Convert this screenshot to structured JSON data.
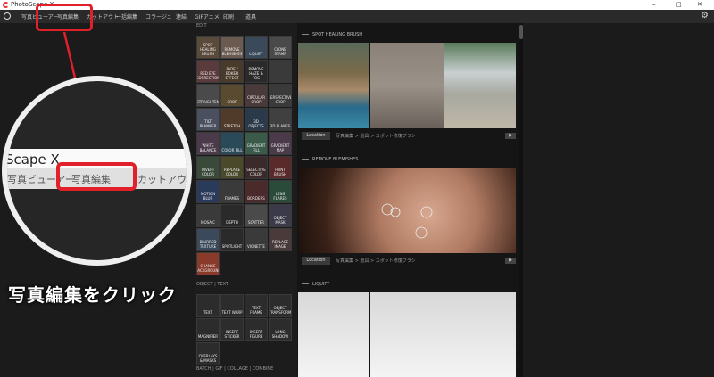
{
  "window": {
    "title": "PhotoScape X",
    "min": "–",
    "max": "□",
    "close": "✕"
  },
  "menu": {
    "items": [
      "写真ビューアー",
      "写真編集",
      "カットアウト",
      "一括編集",
      "コラージュ",
      "連結",
      "GIFアニメ",
      "印刷",
      "道具"
    ]
  },
  "icons": {
    "search": "search-icon",
    "settings": "gear-icon"
  },
  "callout": {
    "title": "Scape X",
    "items": [
      "写真ビューアー",
      "写真編集",
      "カットアウト"
    ]
  },
  "caption": "写真編集をクリック",
  "edit_panel": {
    "sections": [
      "EDIT",
      "OBJECT | TEXT",
      "BATCH | GIF | COLLAGE | COMBINE"
    ],
    "tools": [
      "SPOT HEALING BRUSH",
      "REMOVE BLEMISHES",
      "LIQUIFY",
      "CLONE STAMP",
      "RED EYE CORRECTION",
      "FADE / BOKEH EFFECT",
      "REMOVE HAZE & FOG",
      "",
      "STRAIGHTEN",
      "CROP",
      "CIRCULAR CROP",
      "PERSPECTIVE CROP",
      "TILT PLANNER",
      "STRETCH",
      "3D OBJECTS",
      "3D PLANES",
      "WHITE BALANCE",
      "COLOR FILL",
      "GRADIENT FILL",
      "GRADIENT MAP",
      "INVERT COLOR",
      "REPLACE COLOR",
      "SELECTIVE COLOR",
      "PAINT BRUSH",
      "MOTION BLUR",
      "FRAMES",
      "BORDERS",
      "LENS FLARES",
      "MOSAIC",
      "DEPTH",
      "SCATTER",
      "OBJECT MASK",
      "BLURRED TEXTURE",
      "SPOTLIGHT",
      "VIGNETTE",
      "REPLACE IMAGE",
      "CHANGE BACKGROUND"
    ],
    "object_tools": [
      "TEXT",
      "TEXT WARP",
      "TEXT FRAME",
      "OBJECT TRANSFORM",
      "MAGNIFIER",
      "INSERT STICKER",
      "INSERT FIGURE",
      "LONG SHADOW",
      "OVERLAYS & MASKS"
    ]
  },
  "previews": [
    {
      "title": "SPOT HEALING BRUSH",
      "location": "Location",
      "path": "写真編集 > 道具 > スポット修復ブラシ"
    },
    {
      "title": "REMOVE BLEMISHES",
      "location": "Location",
      "path": "写真編集 > 道具 > スポット修復ブラシ"
    },
    {
      "title": "LIQUIFY"
    }
  ],
  "play_icon": "play-icon",
  "colors": {
    "accent": "#e0202a",
    "background": "#1b1b1b"
  }
}
